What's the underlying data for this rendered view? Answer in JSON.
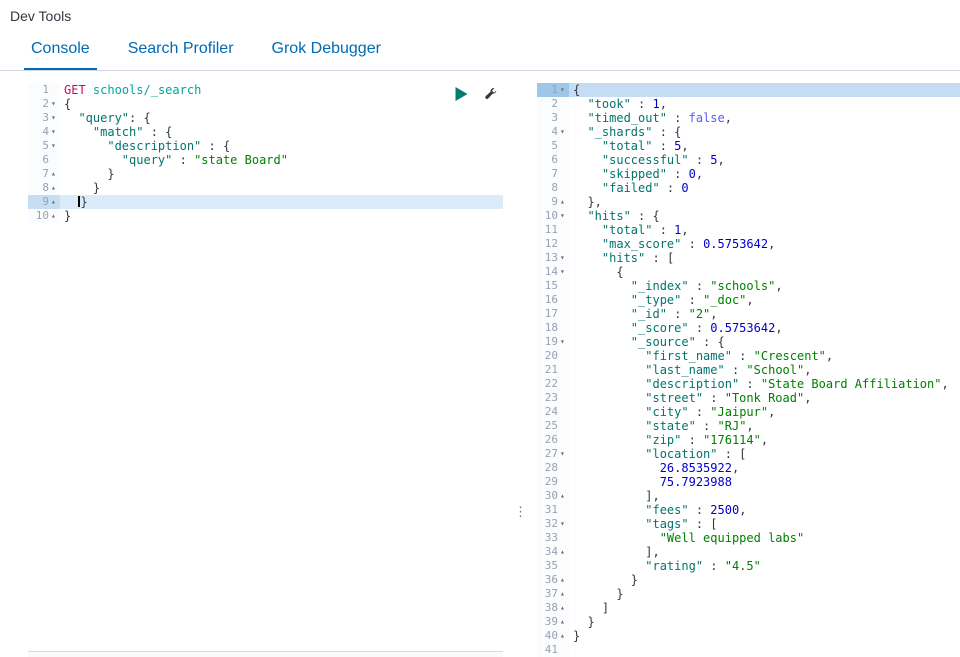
{
  "header": {
    "title": "Dev Tools"
  },
  "tabs": [
    {
      "label": "Console",
      "active": true
    },
    {
      "label": "Search Profiler",
      "active": false
    },
    {
      "label": "Grok Debugger",
      "active": false
    }
  ],
  "icons": {
    "send": "play-icon",
    "settings": "wrench-icon",
    "resizer": "vertical-dots-icon",
    "resizer_glyph": "⋮",
    "fold_open_glyph": "▾",
    "fold_closed_glyph": "▴"
  },
  "colors": {
    "tab_accent": "#006BB4",
    "title_text": "#343741",
    "border": "#D3DAE6",
    "code_text": "#343741",
    "gutter_text": "#98A2B3",
    "method": "#C80A68",
    "url": "#00A69B",
    "key": "#00756C",
    "string": "#008000",
    "number": "#0000CC",
    "boolean": "#585CF6",
    "play_button": "#017D73",
    "active_line": "#DCEBFA",
    "selected_line": "#C4DDF5"
  },
  "request_editor": {
    "lines": [
      {
        "n": 1,
        "tokens": [
          [
            "method",
            "GET"
          ],
          [
            "punc",
            " "
          ],
          [
            "url",
            "schools/_search"
          ]
        ]
      },
      {
        "n": 2,
        "fold": "down",
        "tokens": [
          [
            "punc",
            "{"
          ]
        ]
      },
      {
        "n": 3,
        "fold": "down",
        "tokens": [
          [
            "punc",
            "  "
          ],
          [
            "key",
            "\"query\""
          ],
          [
            "punc",
            ": {"
          ]
        ]
      },
      {
        "n": 4,
        "fold": "down",
        "tokens": [
          [
            "punc",
            "    "
          ],
          [
            "key",
            "\"match\""
          ],
          [
            "punc",
            " : {"
          ]
        ]
      },
      {
        "n": 5,
        "fold": "down",
        "tokens": [
          [
            "punc",
            "      "
          ],
          [
            "key",
            "\"description\""
          ],
          [
            "punc",
            " : {"
          ]
        ]
      },
      {
        "n": 6,
        "tokens": [
          [
            "punc",
            "        "
          ],
          [
            "key",
            "\"query\""
          ],
          [
            "punc",
            " : "
          ],
          [
            "str",
            "\"state Board\""
          ]
        ]
      },
      {
        "n": 7,
        "fold": "up",
        "tokens": [
          [
            "punc",
            "      }"
          ]
        ]
      },
      {
        "n": 8,
        "fold": "up",
        "tokens": [
          [
            "punc",
            "    }"
          ]
        ]
      },
      {
        "n": 9,
        "fold": "up",
        "hl": "active",
        "tokens": [
          [
            "punc",
            "  "
          ],
          [
            "cursor",
            ""
          ],
          [
            "punc",
            "}"
          ]
        ]
      },
      {
        "n": 10,
        "fold": "up",
        "tokens": [
          [
            "punc",
            "}"
          ]
        ]
      }
    ]
  },
  "response_viewer": {
    "lines": [
      {
        "n": 1,
        "fold": "down",
        "hl": "select",
        "tokens": [
          [
            "punc",
            "{"
          ]
        ]
      },
      {
        "n": 2,
        "tokens": [
          [
            "punc",
            "  "
          ],
          [
            "key",
            "\"took\""
          ],
          [
            "punc",
            " : "
          ],
          [
            "num",
            "1"
          ],
          [
            "punc",
            ","
          ]
        ]
      },
      {
        "n": 3,
        "tokens": [
          [
            "punc",
            "  "
          ],
          [
            "key",
            "\"timed_out\""
          ],
          [
            "punc",
            " : "
          ],
          [
            "bool",
            "false"
          ],
          [
            "punc",
            ","
          ]
        ]
      },
      {
        "n": 4,
        "fold": "down",
        "tokens": [
          [
            "punc",
            "  "
          ],
          [
            "key",
            "\"_shards\""
          ],
          [
            "punc",
            " : {"
          ]
        ]
      },
      {
        "n": 5,
        "tokens": [
          [
            "punc",
            "    "
          ],
          [
            "key",
            "\"total\""
          ],
          [
            "punc",
            " : "
          ],
          [
            "num",
            "5"
          ],
          [
            "punc",
            ","
          ]
        ]
      },
      {
        "n": 6,
        "tokens": [
          [
            "punc",
            "    "
          ],
          [
            "key",
            "\"successful\""
          ],
          [
            "punc",
            " : "
          ],
          [
            "num",
            "5"
          ],
          [
            "punc",
            ","
          ]
        ]
      },
      {
        "n": 7,
        "tokens": [
          [
            "punc",
            "    "
          ],
          [
            "key",
            "\"skipped\""
          ],
          [
            "punc",
            " : "
          ],
          [
            "num",
            "0"
          ],
          [
            "punc",
            ","
          ]
        ]
      },
      {
        "n": 8,
        "tokens": [
          [
            "punc",
            "    "
          ],
          [
            "key",
            "\"failed\""
          ],
          [
            "punc",
            " : "
          ],
          [
            "num",
            "0"
          ]
        ]
      },
      {
        "n": 9,
        "fold": "up",
        "tokens": [
          [
            "punc",
            "  },"
          ]
        ]
      },
      {
        "n": 10,
        "fold": "down",
        "tokens": [
          [
            "punc",
            "  "
          ],
          [
            "key",
            "\"hits\""
          ],
          [
            "punc",
            " : {"
          ]
        ]
      },
      {
        "n": 11,
        "tokens": [
          [
            "punc",
            "    "
          ],
          [
            "key",
            "\"total\""
          ],
          [
            "punc",
            " : "
          ],
          [
            "num",
            "1"
          ],
          [
            "punc",
            ","
          ]
        ]
      },
      {
        "n": 12,
        "tokens": [
          [
            "punc",
            "    "
          ],
          [
            "key",
            "\"max_score\""
          ],
          [
            "punc",
            " : "
          ],
          [
            "num",
            "0.5753642"
          ],
          [
            "punc",
            ","
          ]
        ]
      },
      {
        "n": 13,
        "fold": "down",
        "tokens": [
          [
            "punc",
            "    "
          ],
          [
            "key",
            "\"hits\""
          ],
          [
            "punc",
            " : ["
          ]
        ]
      },
      {
        "n": 14,
        "fold": "down",
        "tokens": [
          [
            "punc",
            "      {"
          ]
        ]
      },
      {
        "n": 15,
        "tokens": [
          [
            "punc",
            "        "
          ],
          [
            "key",
            "\"_index\""
          ],
          [
            "punc",
            " : "
          ],
          [
            "str",
            "\"schools\""
          ],
          [
            "punc",
            ","
          ]
        ]
      },
      {
        "n": 16,
        "tokens": [
          [
            "punc",
            "        "
          ],
          [
            "key",
            "\"_type\""
          ],
          [
            "punc",
            " : "
          ],
          [
            "str",
            "\"_doc\""
          ],
          [
            "punc",
            ","
          ]
        ]
      },
      {
        "n": 17,
        "tokens": [
          [
            "punc",
            "        "
          ],
          [
            "key",
            "\"_id\""
          ],
          [
            "punc",
            " : "
          ],
          [
            "str",
            "\"2\""
          ],
          [
            "punc",
            ","
          ]
        ]
      },
      {
        "n": 18,
        "tokens": [
          [
            "punc",
            "        "
          ],
          [
            "key",
            "\"_score\""
          ],
          [
            "punc",
            " : "
          ],
          [
            "num",
            "0.5753642"
          ],
          [
            "punc",
            ","
          ]
        ]
      },
      {
        "n": 19,
        "fold": "down",
        "tokens": [
          [
            "punc",
            "        "
          ],
          [
            "key",
            "\"_source\""
          ],
          [
            "punc",
            " : {"
          ]
        ]
      },
      {
        "n": 20,
        "tokens": [
          [
            "punc",
            "          "
          ],
          [
            "key",
            "\"first_name\""
          ],
          [
            "punc",
            " : "
          ],
          [
            "str",
            "\"Crescent\""
          ],
          [
            "punc",
            ","
          ]
        ]
      },
      {
        "n": 21,
        "tokens": [
          [
            "punc",
            "          "
          ],
          [
            "key",
            "\"last_name\""
          ],
          [
            "punc",
            " : "
          ],
          [
            "str",
            "\"School\""
          ],
          [
            "punc",
            ","
          ]
        ]
      },
      {
        "n": 22,
        "tokens": [
          [
            "punc",
            "          "
          ],
          [
            "key",
            "\"description\""
          ],
          [
            "punc",
            " : "
          ],
          [
            "str",
            "\"State Board Affiliation\""
          ],
          [
            "punc",
            ","
          ]
        ]
      },
      {
        "n": 23,
        "tokens": [
          [
            "punc",
            "          "
          ],
          [
            "key",
            "\"street\""
          ],
          [
            "punc",
            " : "
          ],
          [
            "str",
            "\"Tonk Road\""
          ],
          [
            "punc",
            ","
          ]
        ]
      },
      {
        "n": 24,
        "tokens": [
          [
            "punc",
            "          "
          ],
          [
            "key",
            "\"city\""
          ],
          [
            "punc",
            " : "
          ],
          [
            "str",
            "\"Jaipur\""
          ],
          [
            "punc",
            ","
          ]
        ]
      },
      {
        "n": 25,
        "tokens": [
          [
            "punc",
            "          "
          ],
          [
            "key",
            "\"state\""
          ],
          [
            "punc",
            " : "
          ],
          [
            "str",
            "\"RJ\""
          ],
          [
            "punc",
            ","
          ]
        ]
      },
      {
        "n": 26,
        "tokens": [
          [
            "punc",
            "          "
          ],
          [
            "key",
            "\"zip\""
          ],
          [
            "punc",
            " : "
          ],
          [
            "str",
            "\"176114\""
          ],
          [
            "punc",
            ","
          ]
        ]
      },
      {
        "n": 27,
        "fold": "down",
        "tokens": [
          [
            "punc",
            "          "
          ],
          [
            "key",
            "\"location\""
          ],
          [
            "punc",
            " : ["
          ]
        ]
      },
      {
        "n": 28,
        "tokens": [
          [
            "punc",
            "            "
          ],
          [
            "num",
            "26.8535922"
          ],
          [
            "punc",
            ","
          ]
        ]
      },
      {
        "n": 29,
        "tokens": [
          [
            "punc",
            "            "
          ],
          [
            "num",
            "75.7923988"
          ]
        ]
      },
      {
        "n": 30,
        "fold": "up",
        "tokens": [
          [
            "punc",
            "          ],"
          ]
        ]
      },
      {
        "n": 31,
        "tokens": [
          [
            "punc",
            "          "
          ],
          [
            "key",
            "\"fees\""
          ],
          [
            "punc",
            " : "
          ],
          [
            "num",
            "2500"
          ],
          [
            "punc",
            ","
          ]
        ]
      },
      {
        "n": 32,
        "fold": "down",
        "tokens": [
          [
            "punc",
            "          "
          ],
          [
            "key",
            "\"tags\""
          ],
          [
            "punc",
            " : ["
          ]
        ]
      },
      {
        "n": 33,
        "tokens": [
          [
            "punc",
            "            "
          ],
          [
            "str",
            "\"Well equipped labs\""
          ]
        ]
      },
      {
        "n": 34,
        "fold": "up",
        "tokens": [
          [
            "punc",
            "          ],"
          ]
        ]
      },
      {
        "n": 35,
        "tokens": [
          [
            "punc",
            "          "
          ],
          [
            "key",
            "\"rating\""
          ],
          [
            "punc",
            " : "
          ],
          [
            "str",
            "\"4.5\""
          ]
        ]
      },
      {
        "n": 36,
        "fold": "up",
        "tokens": [
          [
            "punc",
            "        }"
          ]
        ]
      },
      {
        "n": 37,
        "fold": "up",
        "tokens": [
          [
            "punc",
            "      }"
          ]
        ]
      },
      {
        "n": 38,
        "fold": "up",
        "tokens": [
          [
            "punc",
            "    ]"
          ]
        ]
      },
      {
        "n": 39,
        "fold": "up",
        "tokens": [
          [
            "punc",
            "  }"
          ]
        ]
      },
      {
        "n": 40,
        "fold": "up",
        "tokens": [
          [
            "punc",
            "}"
          ]
        ]
      },
      {
        "n": 41,
        "tokens": []
      }
    ]
  }
}
